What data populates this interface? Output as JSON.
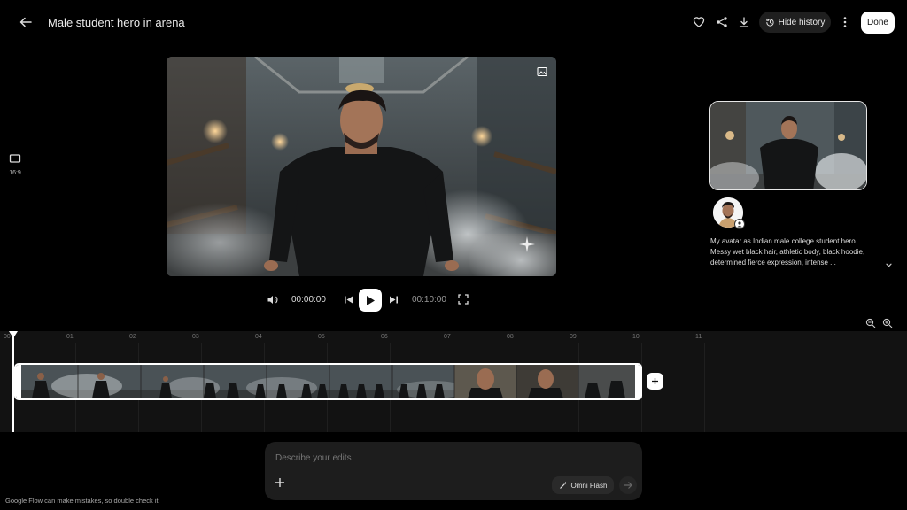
{
  "header": {
    "title": "Male student hero in arena",
    "hide_history_label": "Hide history",
    "done_label": "Done"
  },
  "aspect": {
    "label": "16:9"
  },
  "player": {
    "current_time": "00:00:00",
    "duration": "00:10:00"
  },
  "history": {
    "prompt": "My avatar as Indian male college student hero. Messy wet black hair, athletic body, black hoodie, determined fierce expression, intense ..."
  },
  "timeline": {
    "ticks": [
      "00",
      "01",
      "02",
      "03",
      "04",
      "05",
      "06",
      "07",
      "08",
      "09",
      "10",
      "11"
    ]
  },
  "edit": {
    "placeholder": "Describe your edits",
    "model_label": "Omni Flash"
  },
  "footer": {
    "disclaimer": "Google Flow can make mistakes, so double check it"
  },
  "colors": {
    "background": "#000000",
    "panel": "#121212",
    "accent": "#ffffff"
  }
}
